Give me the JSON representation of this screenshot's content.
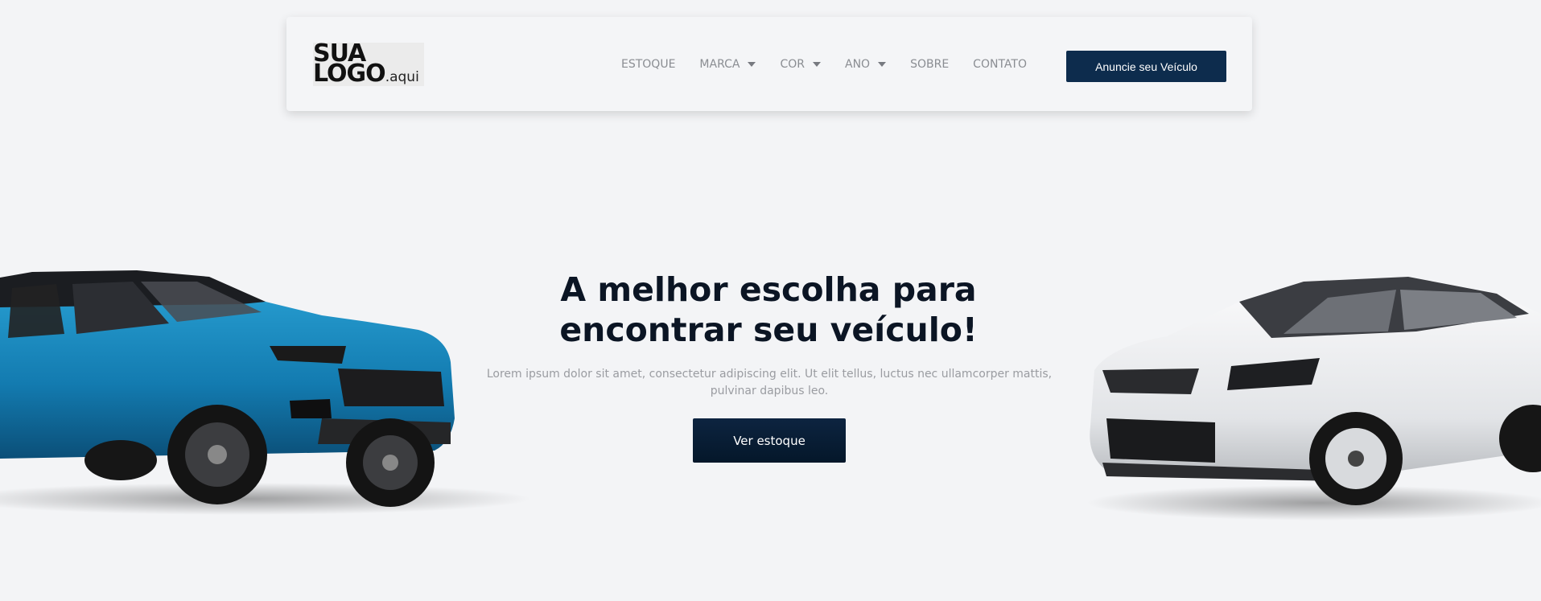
{
  "header": {
    "logo": {
      "line1": "SUA",
      "line2": "LOGO",
      "suffix": ".aqui"
    },
    "nav": [
      {
        "label": "ESTOQUE",
        "dropdown": false
      },
      {
        "label": "MARCA",
        "dropdown": true
      },
      {
        "label": "COR",
        "dropdown": true
      },
      {
        "label": "ANO",
        "dropdown": true
      },
      {
        "label": "SOBRE",
        "dropdown": false
      },
      {
        "label": "CONTATO",
        "dropdown": false
      }
    ],
    "cta_label": "Anuncie seu Veículo"
  },
  "hero": {
    "title_line1": "A melhor escolha para",
    "title_line2": "encontrar seu veículo!",
    "subtitle": "Lorem ipsum dolor sit amet, consectetur adipiscing elit. Ut elit tellus, luctus nec ullamcorper mattis, pulvinar dapibus leo.",
    "button_label": "Ver estoque"
  },
  "colors": {
    "background": "#f3f4f6",
    "accent": "#0d2c4d",
    "title": "#0b1524",
    "muted": "#9a9ca1",
    "car_left": "#1a8fc4",
    "car_right": "#eceef0"
  }
}
